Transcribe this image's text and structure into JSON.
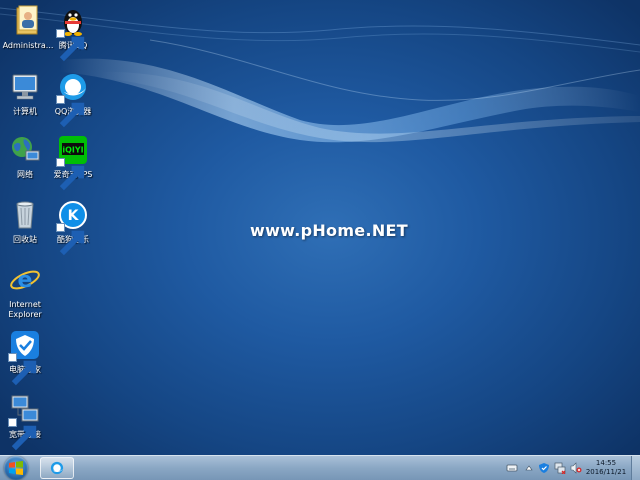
{
  "desktop": {
    "watermark": "www.pHome.NET",
    "icons": [
      {
        "label": "Administra..."
      },
      {
        "label": "腾讯QQ"
      },
      {
        "label": "计算机"
      },
      {
        "label": "QQ浏览器"
      },
      {
        "label": "网络"
      },
      {
        "label": "爱奇艺PPS"
      },
      {
        "label": "回收站"
      },
      {
        "label": "酷狗音乐"
      },
      {
        "label": "Internet\nExplorer",
        "line1": "Internet",
        "line2": "Explorer"
      },
      {
        "label": "电脑管家"
      },
      {
        "label": "宽带连接"
      }
    ]
  },
  "taskbar": {
    "start_icon": "windows-logo-icon",
    "pinned_app_icon": "qq-browser-icon",
    "tray_icons": [
      "keyboard-icon",
      "show-hidden-icons-icon",
      "security-shield-icon",
      "network-icon",
      "volume-muted-icon"
    ],
    "clock": {
      "time": "14:55",
      "date": "2016/11/21"
    }
  },
  "colors": {
    "desktop_blue": "#1f5aa2",
    "taskbar": "#8aa7c4"
  }
}
